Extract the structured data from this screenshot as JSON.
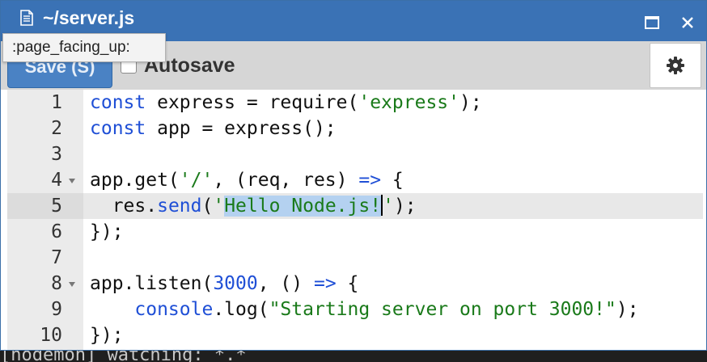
{
  "window": {
    "title": "~/server.js",
    "tooltip": ":page_facing_up:"
  },
  "toolbar": {
    "save_label": "Save (S)",
    "autosave_label": "Autosave",
    "autosave_checked": false
  },
  "background": {
    "terminal_text": "[nodemon] watching: *.*"
  },
  "icons": {
    "document": "document-icon",
    "maximize": "maximize-icon",
    "close": "close-icon",
    "settings": "gear-icon"
  },
  "editor": {
    "active_line": 5,
    "lines": [
      {
        "num": "1"
      },
      {
        "num": "2"
      },
      {
        "num": "3"
      },
      {
        "num": "4",
        "fold": true
      },
      {
        "num": "5"
      },
      {
        "num": "6"
      },
      {
        "num": "7"
      },
      {
        "num": "8",
        "fold": true
      },
      {
        "num": "9"
      },
      {
        "num": "10"
      }
    ],
    "tokens": {
      "l1_kw": "const",
      "l1_rest": " express = require(",
      "l1_str": "'express'",
      "l1_end": ");",
      "l2_kw": "const",
      "l2_rest": " app = express();",
      "l4_a": "app.get(",
      "l4_str": "'/'",
      "l4_b": ", (req, res) ",
      "l4_arrow": "=>",
      "l4_c": " {",
      "l5_a": "  res.",
      "l5_fn": "send",
      "l5_b": "(",
      "l5_q": "'",
      "l5_sel": "Hello Node.js!",
      "l5_q2": "'",
      "l5_end": ");",
      "l6": "});",
      "l8_a": "app.listen(",
      "l8_num": "3000",
      "l8_b": ", () ",
      "l8_arrow": "=>",
      "l8_c": " {",
      "l9_a": "    ",
      "l9_obj": "console",
      "l9_b": ".log(",
      "l9_str": "\"Starting server on port 3000!\"",
      "l9_end": ");",
      "l10": "});"
    }
  },
  "colors": {
    "titlebar": "#3a72b5",
    "save_button": "#4a82c4",
    "keyword": "#1f4fd6",
    "string": "#1a7a1a",
    "selection": "#b4d1f0"
  }
}
